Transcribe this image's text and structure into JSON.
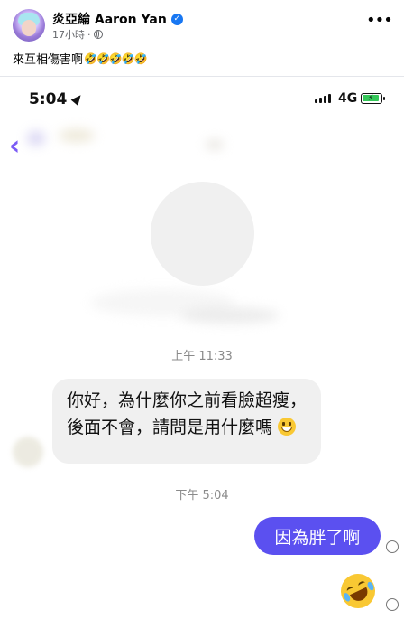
{
  "post": {
    "author": "炎亞綸 Aaron Yan",
    "time": "17小時",
    "separator": "·",
    "caption": "來互相傷害啊",
    "caption_emojis": "🤣🤣🤣🤣🤣",
    "more_icon": "•••"
  },
  "phone": {
    "status_time": "5:04",
    "network": "4G",
    "battery_charging": true,
    "back_icon": "chevron-left-icon",
    "messages": {
      "timestamp_1": "上午 11:33",
      "incoming_text": "你好，為什麼你之前看臉超瘦，後面不會，請問是用什麼嗎",
      "timestamp_2": "下午 5:04",
      "outgoing_text": "因為胖了啊"
    }
  },
  "colors": {
    "accent": "#7b5cf5",
    "outgoing_bubble": "#5b50f0",
    "incoming_bubble": "#f0f0f0",
    "verified": "#1877f2"
  }
}
